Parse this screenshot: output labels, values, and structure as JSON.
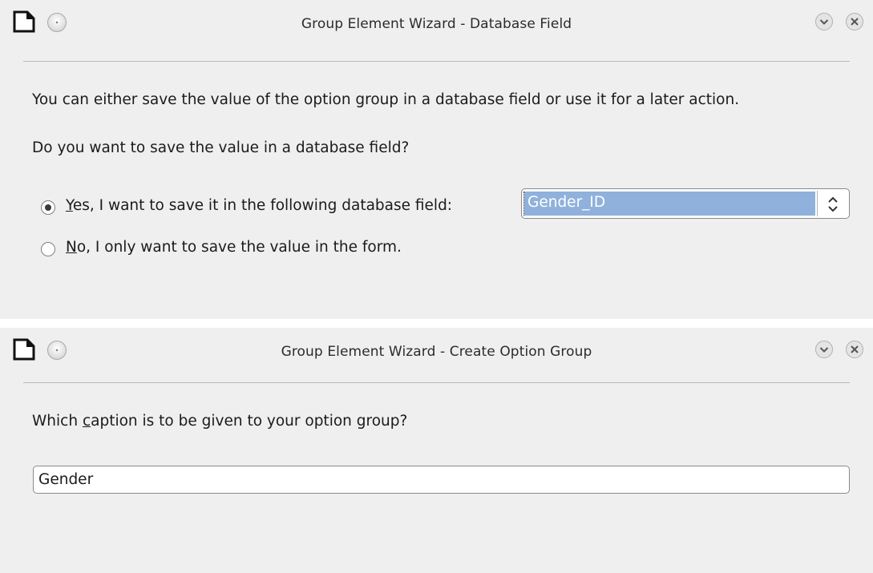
{
  "dialog1": {
    "title": "Group Element Wizard - Database Field",
    "intro": "You can either save the value of the option group in a database field or use it for a later action.",
    "question": "Do you want to save the value in a database field?",
    "option_yes": {
      "mnemonic": "Y",
      "label": "es, I want to save it in the following database field:",
      "selected": true
    },
    "option_no": {
      "mnemonic": "N",
      "label": "o, I only want to save the value in the form.",
      "selected": false
    },
    "field_combo": {
      "value": "Gender_ID"
    }
  },
  "dialog2": {
    "title": "Group Element Wizard - Create Option Group",
    "question": {
      "before": "Which ",
      "mnemonic": "c",
      "after": "aption is to be given to your option group?"
    },
    "caption_input": {
      "value": "Gender"
    }
  },
  "icons": {
    "app": "document-icon",
    "menu": "window-menu-icon",
    "minimize": "chevron-down-icon",
    "close": "close-icon"
  },
  "colors": {
    "selection": "#8fb1dc",
    "window_bg": "#efefef"
  }
}
